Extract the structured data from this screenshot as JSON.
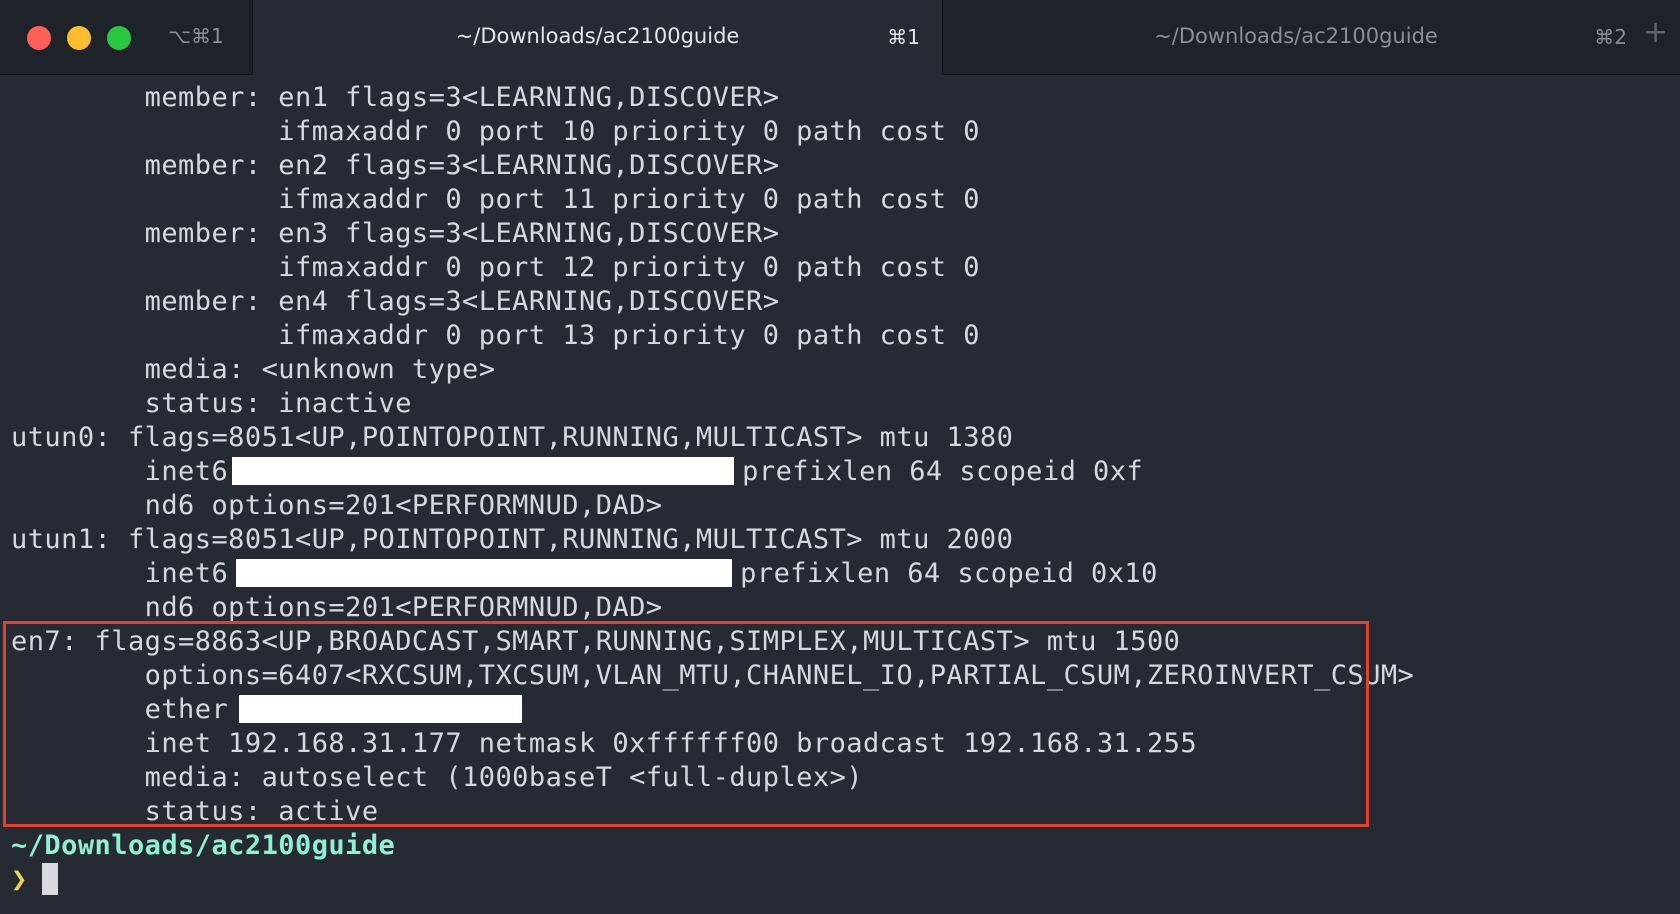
{
  "window": {
    "shortcut": "⌥⌘1",
    "tabs": [
      {
        "title": "~/Downloads/ac2100guide",
        "shortcut": "⌘1",
        "active": true
      },
      {
        "title": "~/Downloads/ac2100guide",
        "shortcut": "⌘2",
        "active": false
      }
    ],
    "new_tab_glyph": "+",
    "traffic_light_colors": {
      "close": "#ff5f57",
      "minimize": "#febc2e",
      "zoom": "#28c840"
    }
  },
  "terminal": {
    "lines": {
      "l0": "        member: en1 flags=3<LEARNING,DISCOVER>",
      "l1": "                ifmaxaddr 0 port 10 priority 0 path cost 0",
      "l2": "        member: en2 flags=3<LEARNING,DISCOVER>",
      "l3": "                ifmaxaddr 0 port 11 priority 0 path cost 0",
      "l4": "        member: en3 flags=3<LEARNING,DISCOVER>",
      "l5": "                ifmaxaddr 0 port 12 priority 0 path cost 0",
      "l6": "        member: en4 flags=3<LEARNING,DISCOVER>",
      "l7": "                ifmaxaddr 0 port 13 priority 0 path cost 0",
      "l8": "        media: <unknown type>",
      "l9": "        status: inactive",
      "l10": "utun0: flags=8051<UP,POINTOPOINT,RUNNING,MULTICAST> mtu 1380",
      "l11_pre": "        inet6",
      "l11_post": "prefixlen 64 scopeid 0xf",
      "l12": "        nd6 options=201<PERFORMNUD,DAD>",
      "l13": "utun1: flags=8051<UP,POINTOPOINT,RUNNING,MULTICAST> mtu 2000",
      "l14_pre": "        inet6",
      "l14_post": "prefixlen 64 scopeid 0x10",
      "l15": "        nd6 options=201<PERFORMNUD,DAD>",
      "l16": "en7: flags=8863<UP,BROADCAST,SMART,RUNNING,SIMPLEX,MULTICAST> mtu 1500",
      "l17": "        options=6407<RXCSUM,TXCSUM,VLAN_MTU,CHANNEL_IO,PARTIAL_CSUM,ZEROINVERT_CSUM>",
      "l18_pre": "        ether",
      "l19": "        inet 192.168.31.177 netmask 0xffffff00 broadcast 192.168.31.255",
      "l20": "        media: autoselect (1000baseT <full-duplex>)",
      "l21": "        status: active"
    },
    "prompt": {
      "path": "~/Downloads/ac2100guide",
      "symbol": "❯"
    },
    "colors": {
      "background": "#252a33",
      "text": "#d5d9df",
      "prompt_path": "#8ff0d2",
      "prompt_symbol": "#e8d25a",
      "highlight_border": "#e0412e"
    }
  }
}
